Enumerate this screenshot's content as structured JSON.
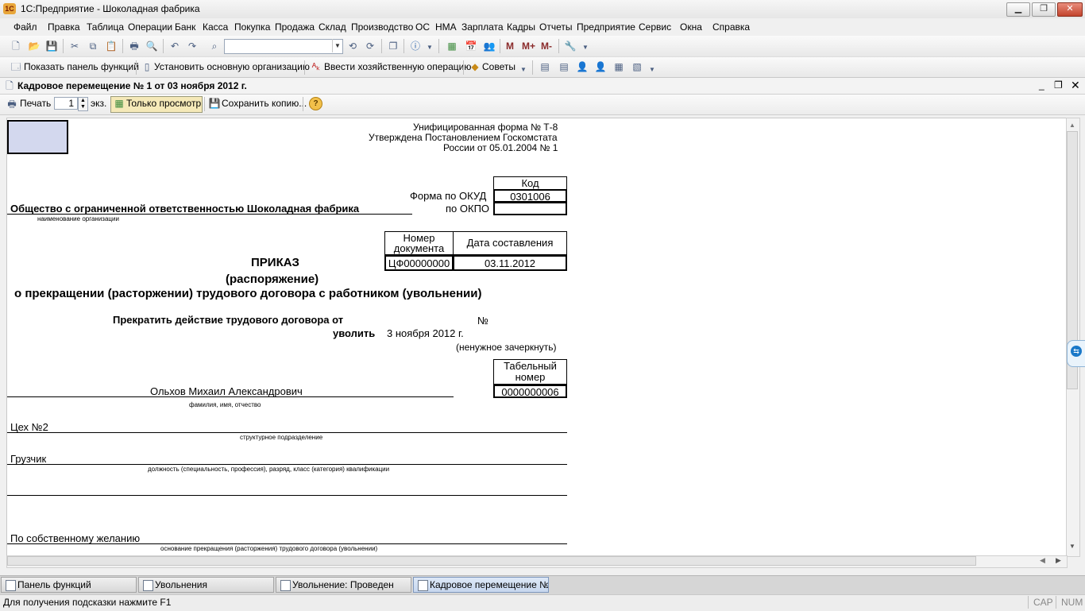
{
  "window": {
    "title": "1С:Предприятие - Шоколадная фабрика",
    "icon_text": "1C"
  },
  "menu": [
    "Файл",
    "Правка",
    "Таблица",
    "Операции",
    "Банк",
    "Касса",
    "Покупка",
    "Продажа",
    "Склад",
    "Производство",
    "ОС",
    "НМА",
    "Зарплата",
    "Кадры",
    "Отчеты",
    "Предприятие",
    "Сервис",
    "Окна",
    "Справка"
  ],
  "toolbar2": {
    "show_panel": "Показать панель функций",
    "set_org": "Установить основную организацию",
    "enter_op": "Ввести хозяйственную операцию",
    "tips": "Советы"
  },
  "toolbar1": {
    "m": "M",
    "m_plus": "M+",
    "m_minus": "M-"
  },
  "doc_window": {
    "title": "Кадровое перемещение  № 1 от 03 ноября 2012 г."
  },
  "doc_toolbar": {
    "print": "Печать",
    "copies": "1",
    "copies_unit": "экз.",
    "readonly": "Только просмотр",
    "save_copy": "Сохранить копию...",
    "help": "?"
  },
  "form": {
    "unified_form": "Унифицированная форма № Т-8",
    "approved_1": "Утверждена Постановлением Госкомстата",
    "approved_2": "России от 05.01.2004 № 1",
    "code_header": "Код",
    "okud_label": "Форма по ОКУД",
    "okud_value": "0301006",
    "okpo_label": "по ОКПО",
    "okpo_value": "",
    "org_name": "Общество с ограниченной ответственностью Шоколадная фабрика",
    "org_caption": "наименование организации",
    "docnum_header": "Номер документа",
    "date_header": "Дата составления",
    "docnum_value": "ЦФ00000000",
    "date_value": "03.11.2012",
    "title_1": "ПРИКАЗ",
    "title_2": "(распоряжение)",
    "title_3": "о прекращении (расторжении) трудового договора с работником (увольнении)",
    "terminate_label": "Прекратить действие трудового договора от",
    "number_sign": "№",
    "dismiss_label": "уволить",
    "dismiss_date": "3 ноября 2012 г.",
    "strike_note": "(ненужное зачеркнуть)",
    "tabnum_header": "Табельный номер",
    "tabnum_value": "0000000006",
    "employee_name": "Ольхов Михаил Александрович",
    "employee_caption": "фамилия, имя, отчество",
    "department": "Цех №2",
    "department_caption": "структурное подразделение",
    "position": "Грузчик",
    "position_caption": "должность (специальность, профессия), разряд, класс (категория) квалификации",
    "reason": "По собственному желанию",
    "reason_caption": "основание прекращения (расторжения) трудового договора (увольнении)"
  },
  "taskbar": [
    "Панель функций",
    "Увольнения",
    "Увольнение: Проведен",
    "Кадровое перемещение  №..."
  ],
  "status": {
    "hint": "Для получения подсказки нажмите F1",
    "cap": "CAP",
    "num": "NUM"
  }
}
